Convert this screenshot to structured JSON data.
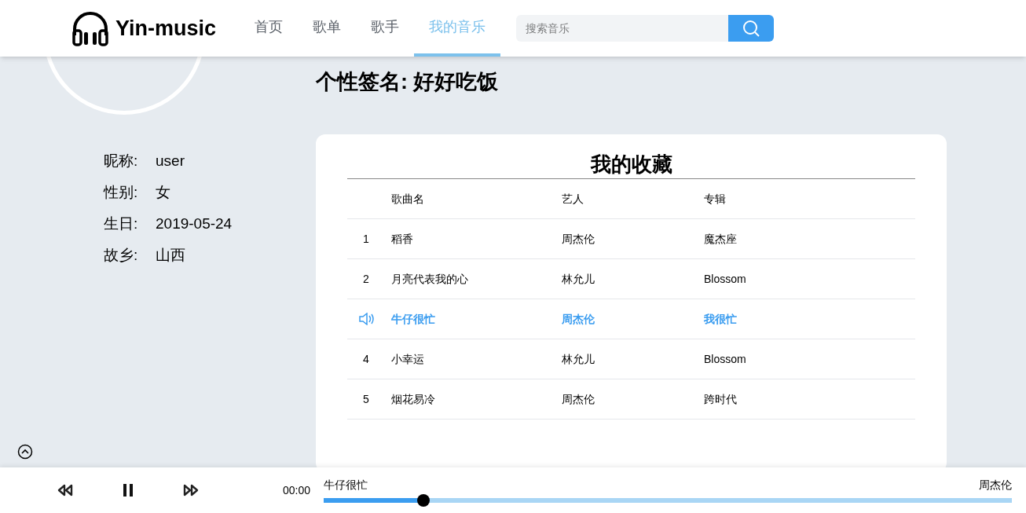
{
  "header": {
    "logo": "Yin-music",
    "nav": [
      {
        "label": "首页",
        "selected": false
      },
      {
        "label": "歌单",
        "selected": false
      },
      {
        "label": "歌手",
        "selected": false
      },
      {
        "label": "我的音乐",
        "selected": true
      }
    ],
    "search": {
      "placeholder": "搜索音乐"
    }
  },
  "signature": "个性签名: 好好吃饭",
  "profile": [
    {
      "label": "昵称:",
      "value": "user"
    },
    {
      "label": "性别:",
      "value": "女"
    },
    {
      "label": "生日:",
      "value": "2019-05-24"
    },
    {
      "label": "故乡:",
      "value": "山西"
    }
  ],
  "favorites": {
    "title": "我的收藏",
    "columns": [
      "歌曲名",
      "艺人",
      "专辑"
    ],
    "rows": [
      {
        "index": "1",
        "playing": false,
        "cells": [
          "稻香",
          "周杰伦",
          "魔杰座"
        ]
      },
      {
        "index": "2",
        "playing": false,
        "cells": [
          "月亮代表我的心",
          "林允儿",
          "Blossom"
        ]
      },
      {
        "playing": true,
        "cells": [
          "牛仔很忙",
          "周杰伦",
          "我很忙"
        ]
      },
      {
        "index": "4",
        "playing": false,
        "cells": [
          "小幸运",
          "林允儿",
          "Blossom"
        ]
      },
      {
        "index": "5",
        "playing": false,
        "cells": [
          "烟花易冷",
          "周杰伦",
          "跨时代"
        ]
      }
    ]
  },
  "player": {
    "time": "00:00",
    "song": "牛仔很忙",
    "artist": "周杰伦",
    "level": 0.145,
    "paused": false
  }
}
